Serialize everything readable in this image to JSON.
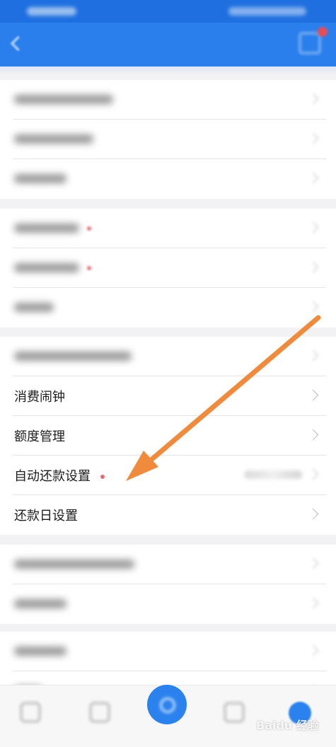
{
  "header": {
    "title": ""
  },
  "groups": [
    {
      "rows": [
        {
          "label": ""
        },
        {
          "label": ""
        },
        {
          "label": ""
        }
      ]
    },
    {
      "rows": [
        {
          "label": ""
        },
        {
          "label": ""
        },
        {
          "label": ""
        }
      ]
    },
    {
      "rows": [
        {
          "label": ""
        },
        {
          "label": "消费闹钟"
        },
        {
          "label": "额度管理"
        },
        {
          "label": "自动还款设置",
          "has_red_dot": true
        },
        {
          "label": "还款日设置"
        }
      ]
    },
    {
      "rows": [
        {
          "label": ""
        },
        {
          "label": ""
        }
      ]
    },
    {
      "rows": [
        {
          "label": ""
        },
        {
          "label": ""
        }
      ]
    }
  ],
  "bottom_nav": {
    "items": [
      {
        "label": ""
      },
      {
        "label": ""
      },
      {
        "label": ""
      },
      {
        "label": ""
      },
      {
        "label": ""
      }
    ]
  },
  "watermark": "Baidu 经验",
  "colors": {
    "header_blue": "#2a7fed",
    "annotation_arrow": "#f08a3c",
    "red_dot": "#e86c74"
  },
  "icons": [
    "back-arrow-icon",
    "message-icon",
    "chevron-right-icon"
  ]
}
